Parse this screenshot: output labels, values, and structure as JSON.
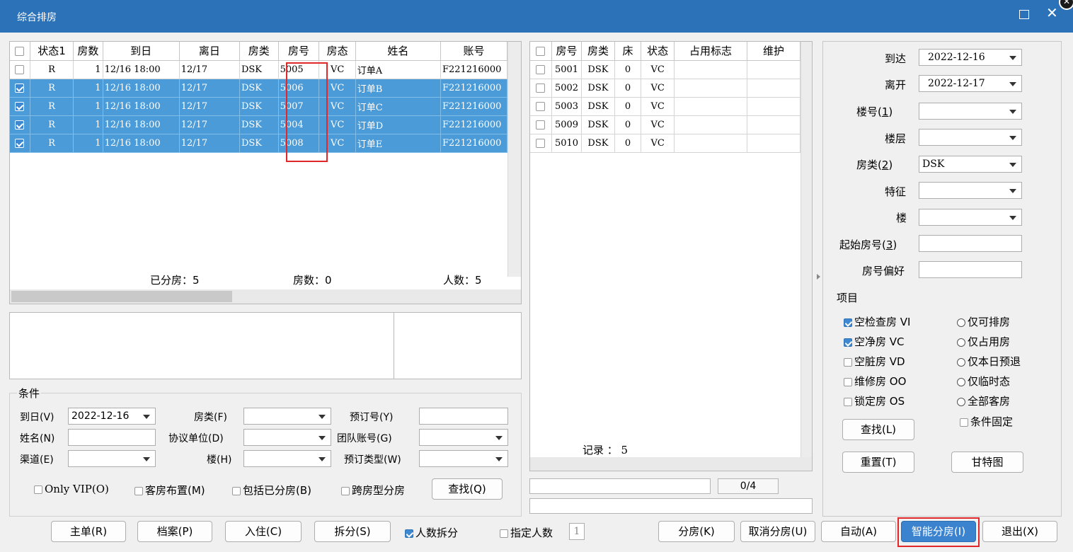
{
  "window": {
    "title": "综合排房"
  },
  "left_grid": {
    "columns": [
      "状态1",
      "房数",
      "到日",
      "离日",
      "房类",
      "房号",
      "房态",
      "姓名",
      "账号"
    ],
    "rows": [
      {
        "checked": false,
        "selected": false,
        "status": "R",
        "count": "1",
        "arrive": "12/16 18:00",
        "depart": "12/17",
        "type": "DSK",
        "room": "5005",
        "state": "VC",
        "name": "订单A",
        "account": "F221216000"
      },
      {
        "checked": true,
        "selected": true,
        "status": "R",
        "count": "1",
        "arrive": "12/16 18:00",
        "depart": "12/17",
        "type": "DSK",
        "room": "5006",
        "state": "VC",
        "name": "订单B",
        "account": "F221216000"
      },
      {
        "checked": true,
        "selected": true,
        "status": "R",
        "count": "1",
        "arrive": "12/16 18:00",
        "depart": "12/17",
        "type": "DSK",
        "room": "5007",
        "state": "VC",
        "name": "订单C",
        "account": "F221216000"
      },
      {
        "checked": true,
        "selected": true,
        "status": "R",
        "count": "1",
        "arrive": "12/16 18:00",
        "depart": "12/17",
        "type": "DSK",
        "room": "5004",
        "state": "VC",
        "name": "订单D",
        "account": "F221216000"
      },
      {
        "checked": true,
        "selected": true,
        "status": "R",
        "count": "1",
        "arrive": "12/16 18:00",
        "depart": "12/17",
        "type": "DSK",
        "room": "5008",
        "state": "VC",
        "name": "订单E",
        "account": "F221216000"
      }
    ],
    "summary": {
      "assigned": "已分房：5",
      "rooms": "房数：0",
      "people": "人数：5"
    }
  },
  "right_grid": {
    "columns": [
      "房号",
      "房类",
      "床",
      "状态",
      "占用标志",
      "维护"
    ],
    "rows": [
      {
        "room": "5001",
        "type": "DSK",
        "bed": "0",
        "status": "VC",
        "occupy": "",
        "maint": ""
      },
      {
        "room": "5002",
        "type": "DSK",
        "bed": "0",
        "status": "VC",
        "occupy": "",
        "maint": ""
      },
      {
        "room": "5003",
        "type": "DSK",
        "bed": "0",
        "status": "VC",
        "occupy": "",
        "maint": ""
      },
      {
        "room": "5009",
        "type": "DSK",
        "bed": "0",
        "status": "VC",
        "occupy": "",
        "maint": ""
      },
      {
        "room": "5010",
        "type": "DSK",
        "bed": "0",
        "status": "VC",
        "occupy": "",
        "maint": ""
      }
    ],
    "records": "记录 ： 5",
    "progress_text": "0/4"
  },
  "conditions": {
    "title": "条件",
    "arrive_label": "到日(V)",
    "arrive_value": "2022-12-16",
    "roomtype_label": "房类(F)",
    "roomtype_value": "",
    "booking_label": "预订号(Y)",
    "booking_value": "",
    "name_label": "姓名(N)",
    "name_value": "",
    "company_label": "协议单位(D)",
    "company_value": "",
    "group_label": "团队账号(G)",
    "group_value": "",
    "channel_label": "渠道(E)",
    "channel_value": "",
    "building_label": "楼(H)",
    "building_value": "",
    "booktype_label": "预订类型(W)",
    "booktype_value": "",
    "only_vip": "Only VIP(O)",
    "layout": "客房布置(M)",
    "include_assigned": "包括已分房(B)",
    "cross_type": "跨房型分房",
    "search_btn": "查找(Q)"
  },
  "filter": {
    "arrive_label": "到达",
    "arrive_value": "2022-12-16",
    "depart_label": "离开",
    "depart_value": "2022-12-17",
    "building_no_label": "楼号(1)",
    "building_no_value": "",
    "floor_label": "楼层",
    "floor_value": "",
    "roomtype_label": "房类(2)",
    "roomtype_value": "DSK",
    "feature_label": "特征",
    "feature_value": "",
    "building_label": "楼",
    "building_value": "",
    "start_room_label": "起始房号(3)",
    "start_room_value": "",
    "pref_label": "房号偏好",
    "pref_value": "",
    "items_title": "项目",
    "checks": [
      {
        "label": "空检查房 VI",
        "checked": true
      },
      {
        "label": "空净房 VC",
        "checked": true
      },
      {
        "label": "空脏房 VD",
        "checked": false
      },
      {
        "label": "维修房 OO",
        "checked": false
      },
      {
        "label": "锁定房 OS",
        "checked": false
      }
    ],
    "radios": [
      "仅可排房",
      "仅占用房",
      "仅本日预退",
      "仅临时态",
      "全部客房"
    ],
    "fixed_condition": "条件固定",
    "search_btn": "查找(L)",
    "reset_btn": "重置(T)",
    "gantt_btn": "甘特图"
  },
  "bottom": {
    "master_btn": "主单(R)",
    "profile_btn": "档案(P)",
    "checkin_btn": "入住(C)",
    "split_btn": "拆分(S)",
    "people_split": "人数拆分",
    "people_split_checked": true,
    "assign_people": "指定人数",
    "assign_people_value": "1",
    "assign_btn": "分房(K)",
    "cancel_assign_btn": "取消分房(U)",
    "auto_btn": "自动(A)",
    "smart_btn": "智能分房(I)",
    "exit_btn": "退出(X)"
  }
}
